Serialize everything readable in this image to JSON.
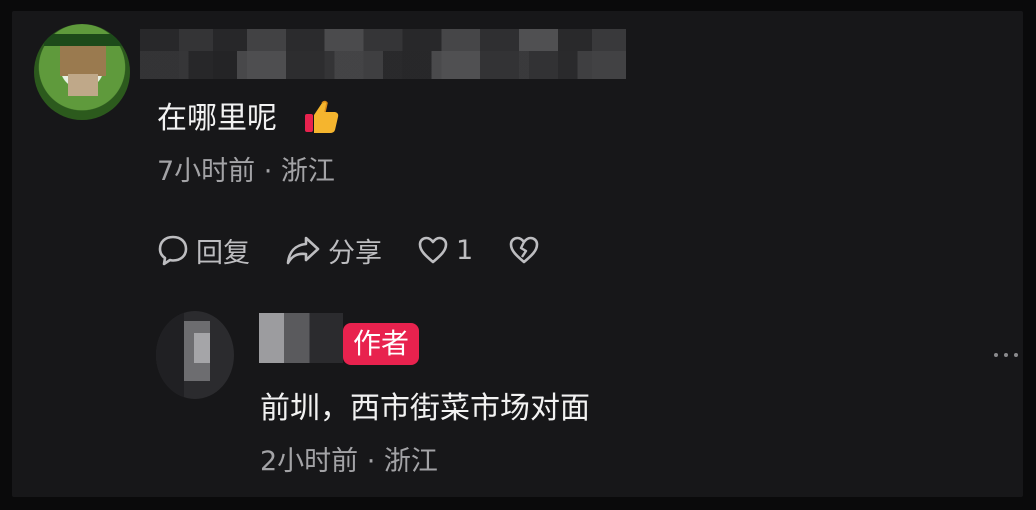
{
  "main_comment": {
    "text": "在哪里呢",
    "emoji": "👍",
    "meta": "7小时前 · 浙江",
    "actions": {
      "reply_label": "回复",
      "share_label": "分享",
      "like_count": "1"
    }
  },
  "reply": {
    "badge": "作者",
    "text": "前圳，西市街菜市场对面",
    "meta": "2小时前 · 浙江"
  },
  "icons": [
    "avatar",
    "thumbs-up-emoji",
    "comment-bubble-icon",
    "share-arrow-icon",
    "heart-icon",
    "broken-heart-icon",
    "more-dots-icon"
  ],
  "colors": {
    "background": "#171719",
    "text_primary": "#f2f2f2",
    "text_secondary": "#a3a3a6",
    "badge": "#e8224e"
  }
}
